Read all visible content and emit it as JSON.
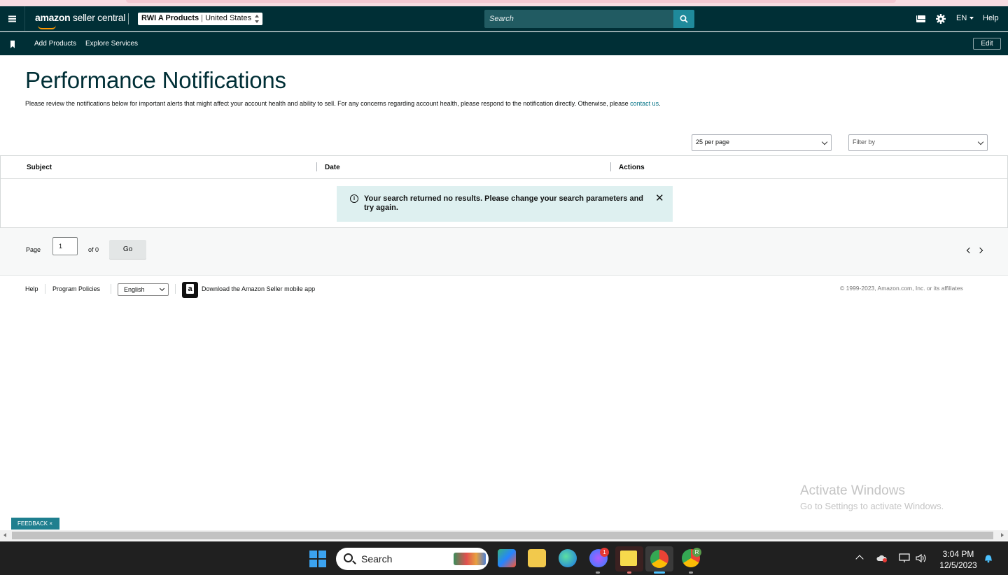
{
  "topnav": {
    "logo_bold": "amazon",
    "logo_rest": " seller central",
    "account_name": "RWI A Products",
    "account_region": "United States",
    "search_placeholder": "Search",
    "language": "EN",
    "help_label": "Help"
  },
  "subnav": {
    "items": [
      {
        "label": "Add Products"
      },
      {
        "label": "Explore Services"
      }
    ],
    "edit_label": "Edit"
  },
  "page": {
    "title": "Performance Notifications",
    "intro_text": "Please review the notifications below for important alerts that might affect your account health and ability to sell. For any concerns regarding account health, please respond to the notification directly. Otherwise, please ",
    "contact_link": "contact us",
    "intro_end": "."
  },
  "controls": {
    "per_page": "25 per page",
    "filter_placeholder": "Filter by"
  },
  "table": {
    "columns": [
      "Subject",
      "Date",
      "Actions"
    ],
    "rows": [],
    "alert_message": "Your search returned no results. Please change your search parameters and try again."
  },
  "pagination": {
    "page_label": "Page",
    "current_page": "1",
    "of_label": "of 0",
    "go_label": "Go"
  },
  "footer": {
    "help": "Help",
    "program_policies": "Program Policies",
    "language_selected": "English",
    "app_download": "Download the Amazon Seller mobile app",
    "copyright": "© 1999-2023, Amazon.com, Inc. or its affiliates"
  },
  "watermark": {
    "title": "Activate Windows",
    "subtitle": "Go to Settings to activate Windows."
  },
  "feedback": {
    "label": "FEEDBACK",
    "close": "×"
  },
  "taskbar": {
    "search_label": "Search",
    "time": "3:04 PM",
    "date": "12/5/2023",
    "messenger_badge": "1",
    "chrome_profile_letter": "R"
  },
  "colors": {
    "nav_bg": "#002f36",
    "search_button": "#1f8a9b",
    "link": "#007185",
    "alert_bg": "#def0f0",
    "feedback_bg": "#1f7f8f"
  }
}
